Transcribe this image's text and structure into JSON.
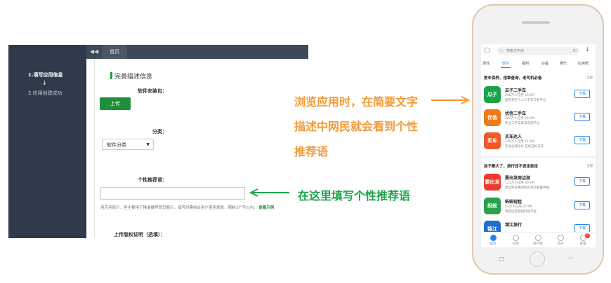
{
  "console": {
    "steps": [
      "1.填写应用信息",
      "2.应用创建成功"
    ],
    "step_arrow": "↓",
    "collapse_icon": "◀◀",
    "home_tab": "首页",
    "section_title": "完善描述信息",
    "field_package": "软件安装包：",
    "upload_button": "上传",
    "field_category": "分类：",
    "category_value": "软件分类",
    "field_slogan": "个性推荐语：",
    "slogan_hint": "用应用简介，但主要用于稀准推荐首页展示，填写时需结合用户使用场景，限制3个字以内。",
    "slogan_example": "查看示例",
    "field_license": "上传版权证明（选填）："
  },
  "annotations": {
    "orange_lines": [
      "浏览应用时，在简要文字",
      "描述中网民就会看到个性",
      "推荐语"
    ],
    "green_line": "在这里填写个性推荐语"
  },
  "phone": {
    "search_placeholder": "搜索文字库",
    "tabs": [
      "游戏",
      "软件",
      "福利",
      "必备",
      "娱乐",
      "应用榜"
    ],
    "active_tab": 1,
    "section1": {
      "title": "爱车保养、违章查询、老司机必备",
      "more": "全部"
    },
    "section2": {
      "title": "孩子都大了，旅行还不说走就走",
      "more": "全部"
    },
    "apps": [
      {
        "name": "瓜子二手车",
        "meta": "206万人在用  16.2M",
        "desc": "国内领先个人二手车交易平台",
        "icon_text": "瓜子",
        "color": "#1aa34a",
        "download": "下载"
      },
      {
        "name": "优信二手车",
        "meta": "260万人在用  28.0M",
        "desc": "专业二手车真实车源平台",
        "icon_text": "优信",
        "color": "#f07a1a",
        "download": "下载"
      },
      {
        "name": "买车达人",
        "meta": "249万人在用  11.6M",
        "desc": "在线全城比价 轻松选好买车",
        "icon_text": "买车",
        "color": "#f05a28",
        "download": "下载"
      },
      {
        "name": "要出发周边游",
        "meta": "121万人在用  30.6M",
        "desc": "周边游优惠团购买酒店套餐神器",
        "icon_text": "要出发",
        "color": "#ef3a2f",
        "download": "下载"
      },
      {
        "name": "蚂蚁短租",
        "meta": "53万人在用  37.0M",
        "desc": "家庭出游短租好房平台",
        "icon_text": "蚂蚁",
        "color": "#2aa048",
        "download": "下载"
      },
      {
        "name": "锦江旅行",
        "meta": "",
        "desc": "",
        "icon_text": "锦江",
        "color": "#1e6fcf",
        "download": "下载"
      }
    ],
    "bottom_nav": [
      "首页",
      "分类",
      "排行榜",
      "热点",
      "管理"
    ],
    "active_nav": 0,
    "badge": "2"
  }
}
